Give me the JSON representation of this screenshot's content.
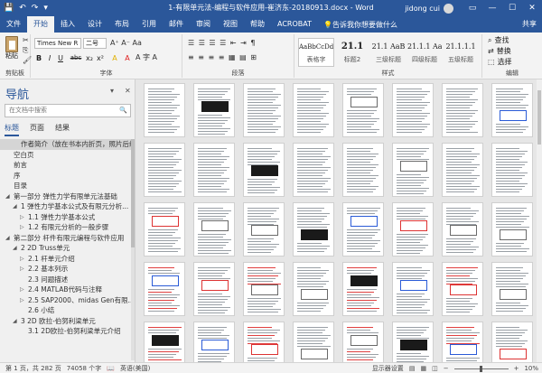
{
  "titlebar": {
    "doc_title": "1-有限单元法-编程与软件应用-崔济东-20180913.docx - Word",
    "user": "jidong cui",
    "quick_access": {
      "save_icon": "💾",
      "undo_icon": "↶",
      "redo_icon": "↷",
      "customize_icon": "▾"
    },
    "window_buttons": {
      "ribbon_display": "▭",
      "minimize": "—",
      "maximize": "☐",
      "close": "✕"
    }
  },
  "tabs": [
    "文件",
    "开始",
    "插入",
    "设计",
    "布局",
    "引用",
    "邮件",
    "审阅",
    "视图",
    "帮助",
    "ACROBAT"
  ],
  "active_tab": "开始",
  "tellme": {
    "icon": "💡",
    "text": "告诉我你想要做什么"
  },
  "share": "共享",
  "ribbon": {
    "clipboard": {
      "paste": "粘贴",
      "label": "剪贴板"
    },
    "font": {
      "font_name": "Times New R",
      "font_size": "二号",
      "label": "字体",
      "row1_extras": "A⁺ A⁻ Aa",
      "buttons": [
        "B",
        "I",
        "U",
        "abc",
        "x₂",
        "x²",
        "A",
        "A"
      ],
      "row2_extras": "A 字 A"
    },
    "paragraph": {
      "label": "段落",
      "row1": "☰ ☰ ☰ ☰ ⇤ ⇥ ¶",
      "row2": "≡ ≡ ≡ ≡ ▦ ▤ ⊞"
    },
    "styles": {
      "label": "样式",
      "items": [
        {
          "sample": "AaBbCcDdI",
          "name": "表格字"
        },
        {
          "sample": "21.1",
          "name": "标题2"
        },
        {
          "sample": "21.1 AaB",
          "name": "三级标题"
        },
        {
          "sample": "21.1.1 Aa",
          "name": "四级标题"
        },
        {
          "sample": "21.1.1.1",
          "name": "五级标题"
        }
      ]
    },
    "editing": {
      "find": "查找",
      "replace": "替换",
      "select": "选择",
      "label": "编辑"
    }
  },
  "nav": {
    "title": "导航",
    "search_placeholder": "在文档中搜索",
    "tabs": [
      "标题",
      "页面",
      "结果"
    ],
    "active_tab": "标题",
    "outline": [
      {
        "text": "作者简介（放在书本内折页，照片后续...",
        "level": 1,
        "tri": ""
      },
      {
        "text": "空白页",
        "level": 0,
        "tri": ""
      },
      {
        "text": "前言",
        "level": 0,
        "tri": ""
      },
      {
        "text": "序",
        "level": 0,
        "tri": ""
      },
      {
        "text": "目录",
        "level": 0,
        "tri": ""
      },
      {
        "text": "第一部分 弹性力学有限单元法基础",
        "level": 0,
        "tri": "◢"
      },
      {
        "text": "1 弹性力学基本公式及有限元分析...",
        "level": 1,
        "tri": "◢"
      },
      {
        "text": "1.1 弹性力学基本公式",
        "level": 2,
        "tri": "▷"
      },
      {
        "text": "1.2 有限元分析的一般步骤",
        "level": 2,
        "tri": "▷"
      },
      {
        "text": "第二部分 杆件有限元编程与软件应用",
        "level": 0,
        "tri": "◢"
      },
      {
        "text": "2 2D Truss单元",
        "level": 1,
        "tri": "◢"
      },
      {
        "text": "2.1 杆单元介绍",
        "level": 2,
        "tri": "▷"
      },
      {
        "text": "2.2 基本列示",
        "level": 2,
        "tri": "▷"
      },
      {
        "text": "2.3 问题描述",
        "level": 2,
        "tri": ""
      },
      {
        "text": "2.4 MATLAB代码与注释",
        "level": 2,
        "tri": "▷"
      },
      {
        "text": "2.5 SAP2000、midas Gen有限...",
        "level": 2,
        "tri": "▷"
      },
      {
        "text": "2.6 小结",
        "level": 2,
        "tri": ""
      },
      {
        "text": "3 2D 欧拉-伯努利梁单元",
        "level": 1,
        "tri": "◢"
      },
      {
        "text": "3.1 2D欧拉-伯努利梁单元介绍",
        "level": 2,
        "tri": ""
      }
    ],
    "selected_index": 0,
    "options_icon": "▾",
    "close_icon": "✕",
    "search_icon": "🔍"
  },
  "status": {
    "page": "第 1 页，共 282 页",
    "words": "74058 个字",
    "proof_icon": "📖",
    "language": "英语(美国)",
    "display_settings": "显示器设置",
    "zoom_minus": "−",
    "zoom_plus": "+",
    "zoom": "10%"
  }
}
